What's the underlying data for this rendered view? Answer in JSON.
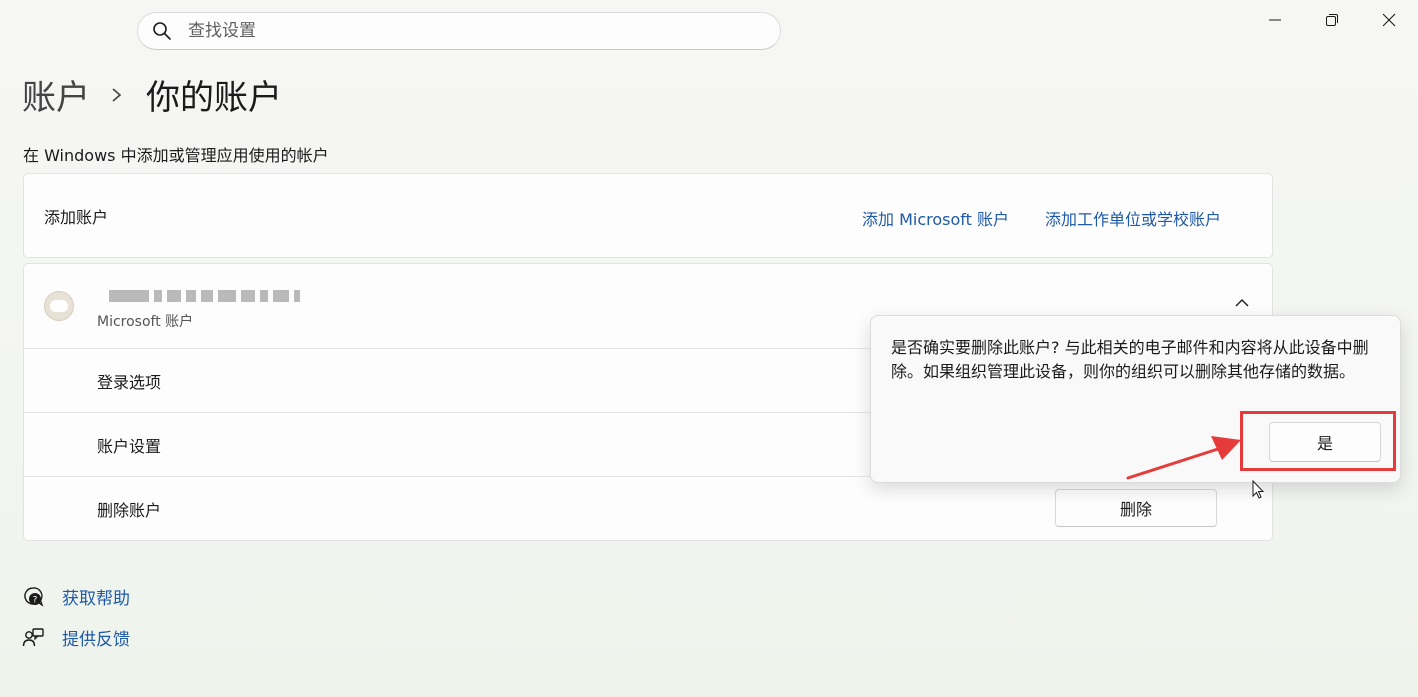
{
  "search": {
    "placeholder": "查找设置"
  },
  "breadcrumb": {
    "parent": "账户",
    "current": "你的账户"
  },
  "subtitle": "在 Windows 中添加或管理应用使用的帐户",
  "add_card": {
    "label": "添加账户",
    "link_microsoft": "添加 Microsoft 账户",
    "link_work": "添加工作单位或学校账户"
  },
  "account": {
    "type": "Microsoft 账户",
    "rows": {
      "sign_in": "登录选项",
      "settings": "账户设置",
      "remove": "删除账户"
    },
    "remove_button": "删除"
  },
  "flyout": {
    "message": "是否确实要删除此账户? 与此相关的电子邮件和内容将从此设备中删除。如果组织管理此设备，则你的组织可以删除其他存储的数据。",
    "confirm": "是"
  },
  "footer": {
    "help": "获取帮助",
    "feedback": "提供反馈"
  },
  "colors": {
    "accent": "#1e5aa8",
    "annotation": "#e53b3b"
  }
}
